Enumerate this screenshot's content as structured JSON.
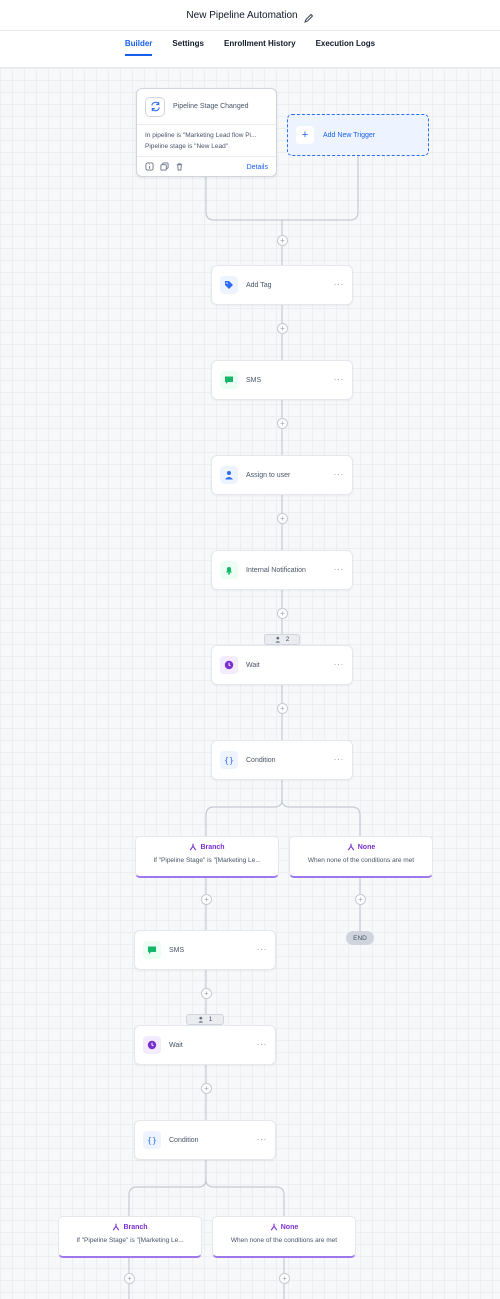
{
  "header": {
    "title": "New Pipeline Automation",
    "tabs": [
      {
        "label": "Builder",
        "active": true
      },
      {
        "label": "Settings",
        "active": false
      },
      {
        "label": "Enrollment History",
        "active": false
      },
      {
        "label": "Execution Logs",
        "active": false
      }
    ]
  },
  "trigger": {
    "label": "Pipeline Stage Changed",
    "line1": "In pipeline is \"Marketing Lead flow Pi...",
    "line2": "Pipeline stage is \"New Lead\"",
    "details_label": "Details"
  },
  "add_trigger": {
    "label": "Add New Trigger"
  },
  "actions": {
    "add_tag": "Add Tag",
    "sms_1": "SMS",
    "assign_user": "Assign to user",
    "internal_notification": "Internal Notification",
    "wait_1": "Wait",
    "condition_1": "Condition",
    "sms_2": "SMS",
    "wait_2": "Wait",
    "condition_2": "Condition",
    "more": "···"
  },
  "wait_badges": {
    "first": "2",
    "second": "1"
  },
  "branches": {
    "branch_label": "Branch",
    "branch_desc": "If \"Pipeline Stage\" is \"[Marketing Le...",
    "none_label": "None",
    "none_desc": "When none of the conditions are met"
  },
  "end_label": "END",
  "colors": {
    "accent": "#155eef",
    "branch": "#7a2fd0",
    "sms": "#12b76a",
    "wait": "#7a2fd0"
  }
}
